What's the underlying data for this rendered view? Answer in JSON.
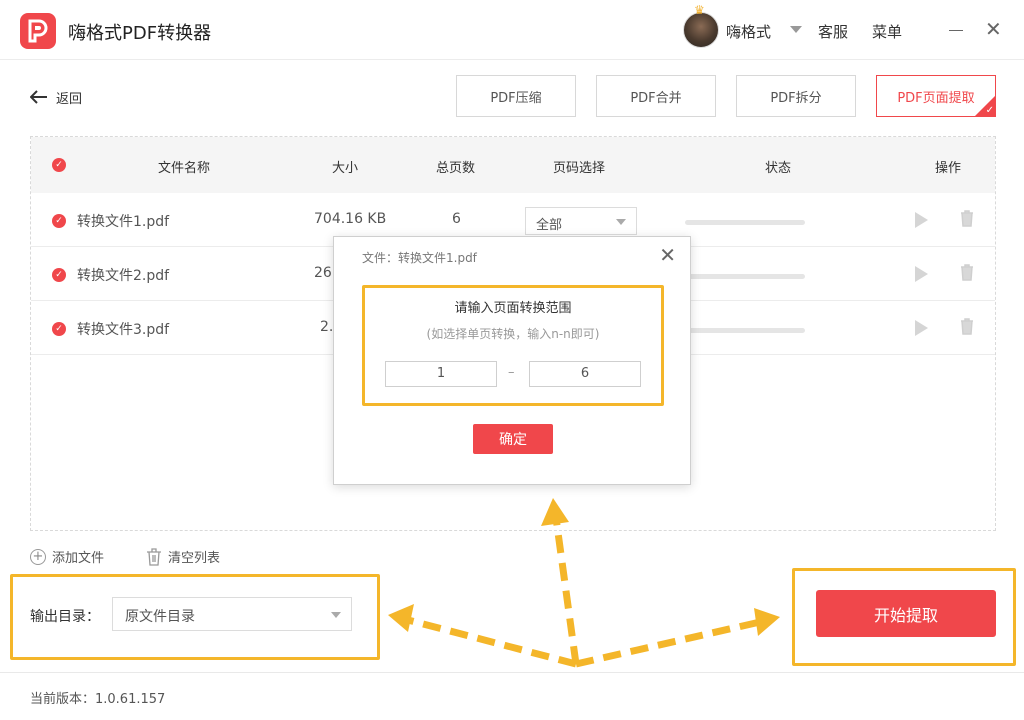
{
  "app": {
    "title": "嗨格式PDF转换器"
  },
  "header": {
    "user_name": "嗨格式",
    "service": "客服",
    "menu": "菜单"
  },
  "toolbar": {
    "back_label": "返回",
    "buttons": [
      "PDF压缩",
      "PDF合并",
      "PDF拆分",
      "PDF页面提取"
    ],
    "active": "PDF页面提取"
  },
  "table": {
    "columns": [
      "文件名称",
      "大小",
      "总页数",
      "页码选择",
      "状态",
      "操作"
    ],
    "rows": [
      {
        "name": "转换文件1.pdf",
        "size": "704.16 KB",
        "pages": "6",
        "page_select": "全部"
      },
      {
        "name": "转换文件2.pdf",
        "size": "26"
      },
      {
        "name": "转换文件3.pdf",
        "size": "2."
      }
    ]
  },
  "dialog": {
    "title": "文件：转换文件1.pdf",
    "heading": "请输入页面转换范围",
    "hint": "(如选择单页转换，输入n-n即可)",
    "from": "1",
    "separator": "–",
    "to": "6",
    "ok": "确定"
  },
  "actions": {
    "add_file": "添加文件",
    "clear_list": "清空列表"
  },
  "output": {
    "label": "输出目录：",
    "value": "原文件目录"
  },
  "start_button": "开始提取",
  "footer": {
    "version": "当前版本：1.0.61.157"
  },
  "colors": {
    "accent": "#f0474b",
    "highlight": "#f4b62a"
  }
}
